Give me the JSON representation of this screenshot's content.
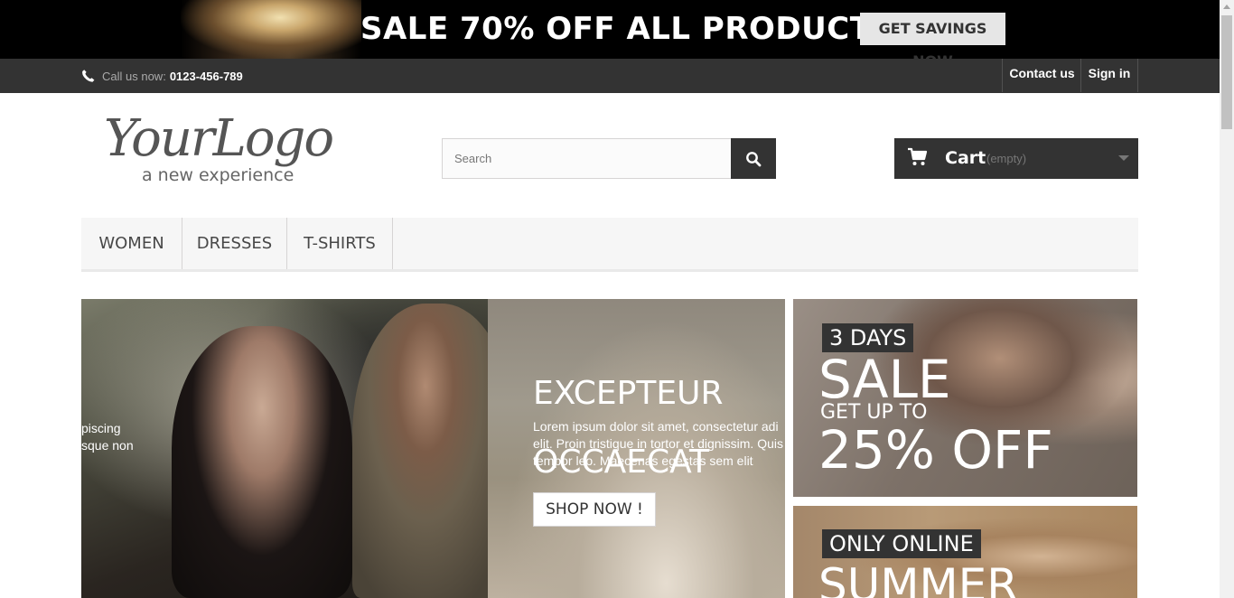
{
  "promo": {
    "text": "SALE 70% OFF ALL PRODUCTS",
    "button": "GET SAVINGS NOW"
  },
  "navbar": {
    "call_label": "Call us now:",
    "phone": "0123-456-789",
    "contact": "Contact us",
    "signin": "Sign in",
    "icons": {
      "phone": "phone-icon"
    }
  },
  "header": {
    "logo_title": "YourLogo",
    "logo_tagline": "a new experience",
    "search_placeholder": "Search",
    "cart_label": "Cart",
    "cart_status": "(empty)",
    "icons": {
      "search": "search-icon",
      "cart": "cart-icon",
      "caret": "caret-down-icon"
    }
  },
  "menu": {
    "items": [
      "WOMEN",
      "DRESSES",
      "T-SHIRTS"
    ]
  },
  "slider": {
    "left_fragment": [
      "piscing",
      "sque non"
    ],
    "title": [
      "EXCEPTEUR",
      "OCCAECAT"
    ],
    "description": [
      "Lorem ipsum dolor sit amet, consectetur adi",
      "elit. Proin tristique in tortor et dignissim. Quis",
      "tempor leo. Maecenas egestas sem elit"
    ],
    "button": "SHOP NOW !"
  },
  "banners": [
    {
      "tag": "3 DAYS",
      "headline": "SALE",
      "subline": "GET UP TO",
      "offer": "25% OFF"
    },
    {
      "tag": "ONLY ONLINE",
      "headline": "SUMMER"
    }
  ],
  "colors": {
    "dark": "#333333",
    "promo_bg": "#000000",
    "menu_bg": "#f6f6f6",
    "white": "#ffffff"
  }
}
